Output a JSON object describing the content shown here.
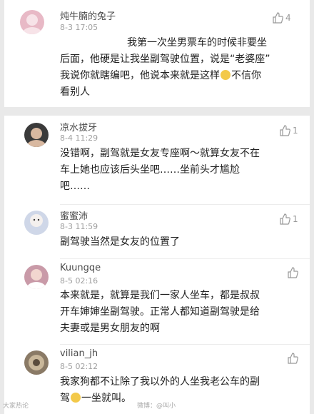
{
  "comments": [
    {
      "username": "炖牛腩的兔子",
      "time": "8-3 17:05",
      "likes": "4",
      "lines": [
        "我第一次坐男票车的时候非要坐",
        "后面，他硬是让我坐副驾驶位置，说是“老婆座”",
        "我说你就瞎编吧，他说本来就是这样",
        "不信你",
        "看别人"
      ]
    },
    {
      "username": "凉水拔牙",
      "time": "8-4 11:29",
      "likes": "1",
      "lines": [
        "没错啊，副驾就是女友专座啊～就算女友不在",
        "车上她也应该后头坐吧……坐前头才尴尬",
        "吧……"
      ]
    },
    {
      "username": "蜜蜜沛",
      "time": "8-3 11:59",
      "likes": "1",
      "lines": [
        "副驾驶当然是女友的位置了"
      ]
    },
    {
      "username": "Kuungqe",
      "time": "8-5 02:16",
      "likes": "",
      "lines": [
        "本来就是，就算是我们一家人坐车，都是叔叔",
        "开车婶婶坐副驾驶。正常人都知道副驾驶是给",
        "夫妻或是男女朋友的啊"
      ]
    },
    {
      "username": "vilian_jh",
      "time": "8-5 02:12",
      "likes": "",
      "lines": [
        "我家狗都不让除了我以外的人坐我老公车的副",
        "驾",
        "一坐就叫。"
      ]
    }
  ],
  "watermarks": {
    "left": "大家热论",
    "center": "微博：@叫小"
  },
  "colors": {
    "avatar1": "#e8b9c6",
    "avatar2": "#3a3a3a",
    "avatar3": "#cfd7e8",
    "avatar4": "#c99aa8",
    "avatar5": "#8a7a66"
  }
}
